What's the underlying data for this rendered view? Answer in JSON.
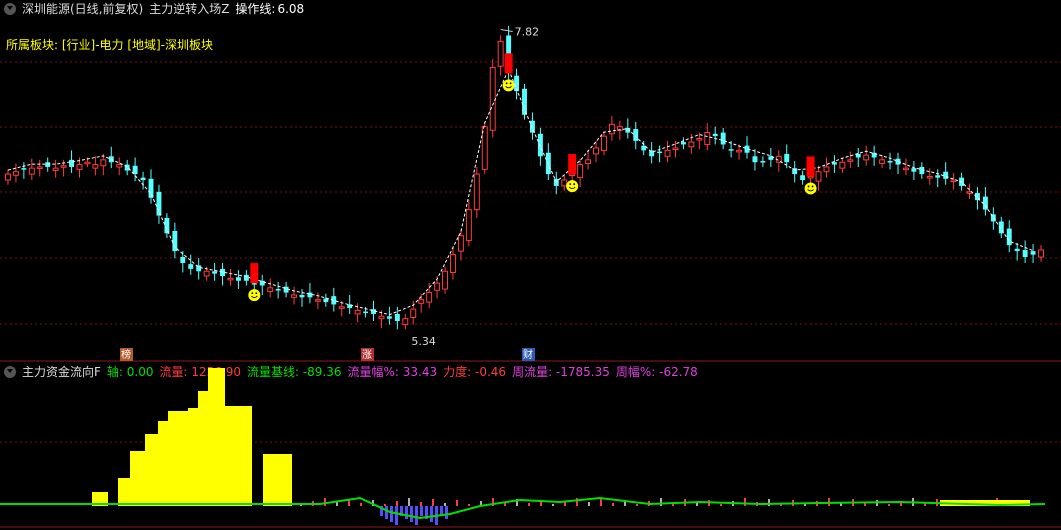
{
  "main_header": {
    "stock_title": "深圳能源(日线,前复权)",
    "indicator_name": "主力逆转入场Z",
    "op_line_label": "操作线:",
    "op_line_value": "6.08"
  },
  "sector_line": "所属板块: [行业]-电力 [地域]-深圳板块",
  "sub_header": {
    "indicator_name": "主力资金流向F",
    "items": [
      {
        "label": "轴:",
        "value": "0.00",
        "color": "#00e000"
      },
      {
        "label": "流量:",
        "value": "1256.90",
        "color": "#ff3c3c"
      },
      {
        "label": "流量基线:",
        "value": "-89.36",
        "color": "#00e000"
      },
      {
        "label": "流量幅%:",
        "value": "33.43",
        "color": "#e040e0"
      },
      {
        "label": "力度:",
        "value": "-0.46",
        "color": "#ff3c3c"
      },
      {
        "label": "周流量:",
        "value": "-1785.35",
        "color": "#e040e0"
      },
      {
        "label": "周幅%:",
        "value": "-62.78",
        "color": "#e040e0"
      }
    ]
  },
  "markers": {
    "high_label": "7.82",
    "low_label": "5.34",
    "badges": [
      {
        "text": "榜",
        "index": 25,
        "bg": "#b35a2a"
      },
      {
        "text": "涨",
        "index": 75,
        "bg": "#b33030"
      },
      {
        "text": "财",
        "index": 110,
        "bg": "#2a5ab3"
      }
    ],
    "smiley_indices": [
      60,
      121,
      135,
      193
    ]
  },
  "colors": {
    "up": "#ff3c3c",
    "down": "#54ffff",
    "signal": "#ff0000",
    "smiley": "#ffff00",
    "flow_bar": "#ffff00",
    "baseline": "#00e000",
    "neg_flow": "#5050ff",
    "grid": "#7a1010"
  },
  "chart_data": {
    "type": "candlestick",
    "price_range": [
      5.2,
      7.9
    ],
    "close": [
      6.6,
      6.62,
      6.64,
      6.65,
      6.66,
      6.66,
      6.65,
      6.67,
      6.66,
      6.68,
      6.7,
      6.68,
      6.72,
      6.7,
      6.68,
      6.63,
      6.6,
      6.55,
      6.4,
      6.25,
      6.1,
      5.95,
      5.85,
      5.8,
      5.78,
      5.78,
      5.76,
      5.74,
      5.72,
      5.7,
      5.7,
      5.68,
      5.66,
      5.64,
      5.62,
      5.6,
      5.58,
      5.56,
      5.56,
      5.54,
      5.52,
      5.5,
      5.48,
      5.47,
      5.45,
      5.43,
      5.42,
      5.4,
      5.38,
      5.36,
      5.38,
      5.46,
      5.54,
      5.6,
      5.68,
      5.78,
      5.92,
      6.08,
      6.3,
      6.6,
      7.0,
      7.5,
      7.72,
      7.45,
      7.3,
      7.1,
      6.95,
      6.75,
      6.6,
      6.5,
      6.55,
      6.6,
      6.68,
      6.72,
      6.82,
      6.92,
      7.02,
      7.0,
      6.95,
      6.88,
      6.8,
      6.75,
      6.78,
      6.8,
      6.82,
      6.85,
      6.87,
      6.9,
      6.95,
      6.92,
      6.85,
      6.8,
      6.8,
      6.78,
      6.7,
      6.7,
      6.72,
      6.75,
      6.7,
      6.6,
      6.55,
      6.58,
      6.62,
      6.66,
      6.68,
      6.7,
      6.72,
      6.74,
      6.76,
      6.74,
      6.72,
      6.7,
      6.68,
      6.65,
      6.62,
      6.6,
      6.58,
      6.57,
      6.56,
      6.55,
      6.5,
      6.45,
      6.38,
      6.3,
      6.2,
      6.1,
      6.0,
      5.95,
      5.9,
      5.92,
      5.96
    ]
  }
}
